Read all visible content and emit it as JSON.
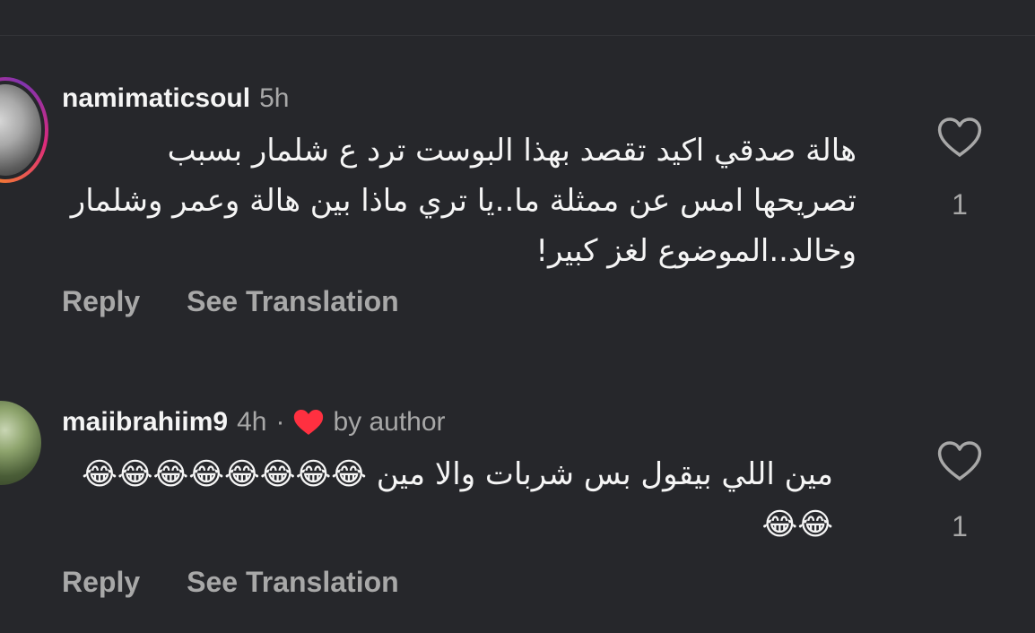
{
  "comments": [
    {
      "username": "namimaticsoul",
      "time": "5h",
      "text": "هالة صدقي اكيد تقصد بهذا البوست ترد ع شلمار بسبب تصريحها امس عن ممثلة ما..يا تري ماذا بين هالة وعمر وشلمار وخالد..الموضوع لغز كبير!",
      "like_count": "1",
      "reply_label": "Reply",
      "translate_label": "See Translation",
      "liked_by_author": false
    },
    {
      "username": "maiibrahiim9",
      "time": "4h",
      "separator": "·",
      "author_badge": "by author",
      "text": "مين اللي بيقول بس شربات والا مين 😂😂😂😂😂😂😂😂😂😂",
      "like_count": "1",
      "reply_label": "Reply",
      "translate_label": "See Translation",
      "liked_by_author": true
    }
  ],
  "colors": {
    "background": "#26272b",
    "primary_text": "#f5f5f5",
    "secondary_text": "#a8a8a8",
    "author_heart": "#ff3040"
  },
  "icons": {
    "like": "heart-outline-icon",
    "author_like": "heart-filled-icon"
  }
}
